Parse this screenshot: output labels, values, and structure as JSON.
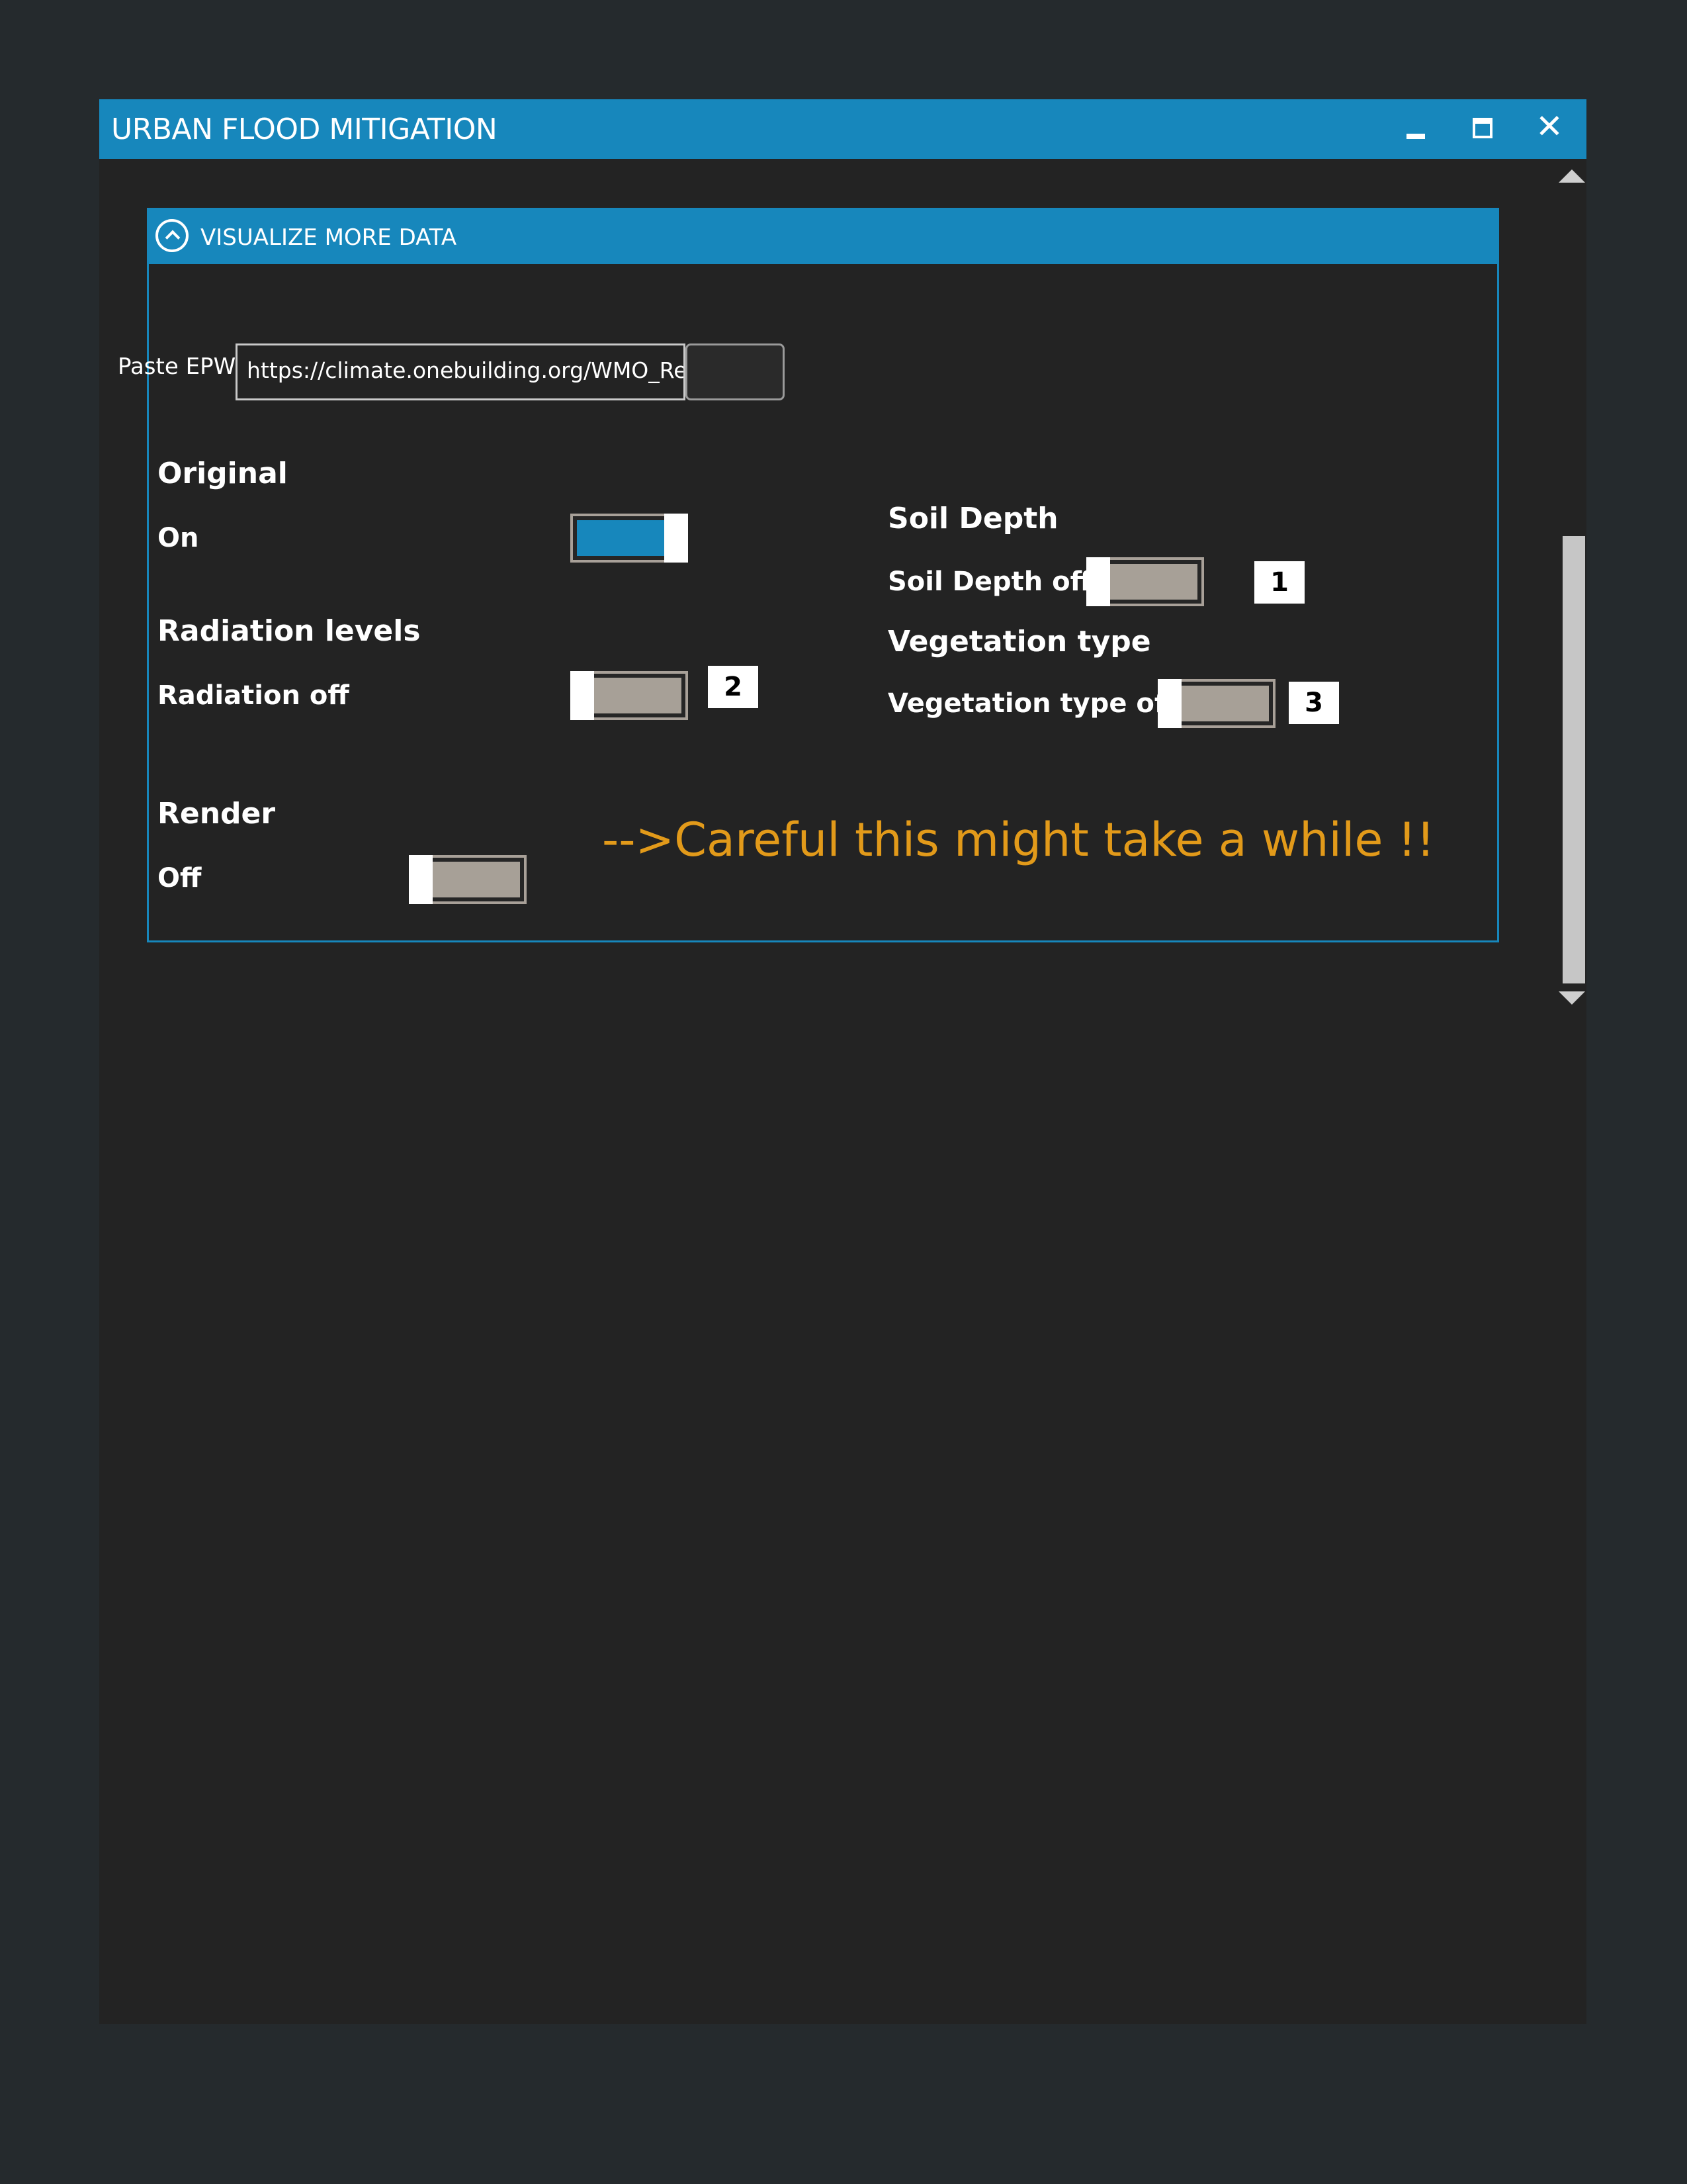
{
  "window": {
    "title": "URBAN FLOOD MITIGATION"
  },
  "panel": {
    "title": "VISUALIZE MORE DATA"
  },
  "epw": {
    "label": "Paste EPW",
    "value": "https://climate.onebuilding.org/WMO_Re"
  },
  "original": {
    "heading": "Original",
    "state_label": "On",
    "state": "on"
  },
  "radiation": {
    "heading": "Radiation levels",
    "state_label": "Radiation off",
    "state": "off",
    "badge": "2"
  },
  "render": {
    "heading": "Render",
    "state_label": "Off",
    "state": "off",
    "warning": "-->Careful this might take a while !!"
  },
  "soil_depth": {
    "heading": "Soil Depth",
    "state_label": "Soil Depth off",
    "state": "off",
    "badge": "1"
  },
  "vegetation": {
    "heading": "Vegetation type",
    "state_label": "Vegetation type off",
    "state": "off",
    "badge": "3"
  },
  "colors": {
    "accent": "#1787bc",
    "background": "#232323",
    "warning": "#e29a1a",
    "toggle_off": "#a7a097"
  },
  "icons": {
    "minimize": "minimize-icon",
    "maximize": "maximize-icon",
    "close": "close-icon",
    "collapse": "chevron-up-circle-icon"
  }
}
